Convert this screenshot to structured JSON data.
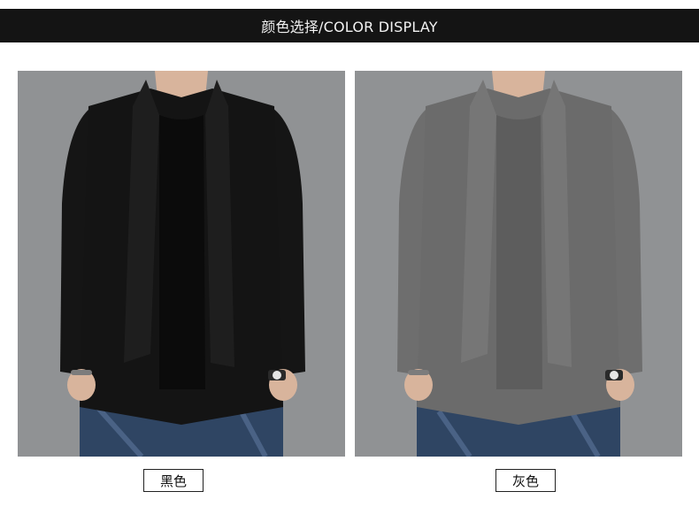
{
  "header": {
    "title": "颜色选择/COLOR DISPLAY"
  },
  "products": [
    {
      "label": "黑色",
      "jacket_color": "#141414",
      "shirt_color": "#0c0c0c"
    },
    {
      "label": "灰色",
      "jacket_color": "#6b6b6b",
      "shirt_color": "#5e5e5e"
    }
  ],
  "colors": {
    "header_bg": "#141414",
    "photo_bg": "#8f9193",
    "jeans": "#2f4563",
    "skin": "#d8b49c"
  }
}
